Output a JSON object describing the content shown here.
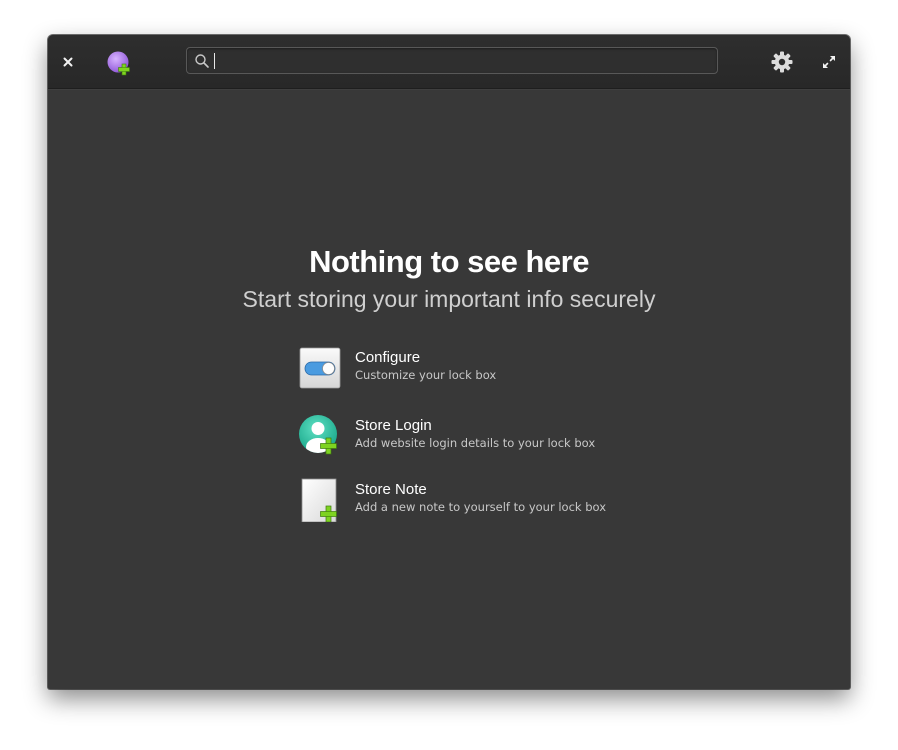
{
  "window": {
    "background": "#383838",
    "headerbar_background": "#2b2b2b"
  },
  "headerbar": {
    "close_icon": "close-icon",
    "app_icon": "add-account-purple-icon",
    "settings_icon": "gear-icon",
    "maximize_icon": "maximize-icon",
    "search": {
      "value": "",
      "placeholder": "",
      "icon": "search-icon"
    }
  },
  "welcome": {
    "title": "Nothing to see here",
    "subtitle": "Start storing your important info securely",
    "actions": [
      {
        "label": "Configure",
        "description": "Customize your lock box",
        "icon": "toggle-switch-icon"
      },
      {
        "label": "Store Login",
        "description": "Add website login details to your lock box",
        "icon": "add-user-icon"
      },
      {
        "label": "Store Note",
        "description": "Add a new note to yourself to your lock box",
        "icon": "add-note-icon"
      }
    ]
  },
  "colors": {
    "accent_green": "#7ed321",
    "teal": "#2ec5a4",
    "purple": "#b07ce8",
    "switch_blue": "#4a9be0"
  }
}
